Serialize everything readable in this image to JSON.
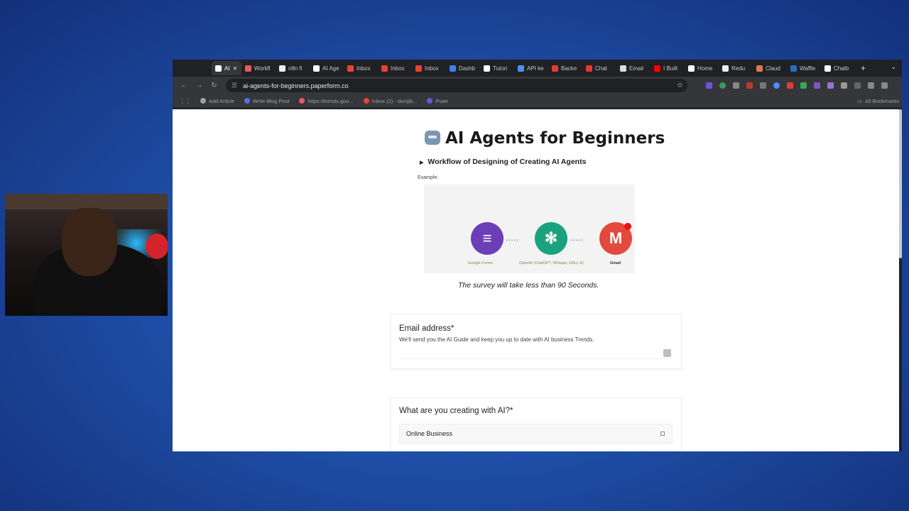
{
  "browser": {
    "tabs": [
      {
        "label": "AI",
        "color": "#ffffff",
        "active": true
      },
      {
        "label": "Workfl",
        "color": "#e65b5b"
      },
      {
        "label": "n8n fi",
        "color": "#eeeeee"
      },
      {
        "label": "AI Age",
        "color": "#ffffff"
      },
      {
        "label": "Inbox",
        "color": "#e94235"
      },
      {
        "label": "Inbox",
        "color": "#e94235"
      },
      {
        "label": "Inbox",
        "color": "#e94235"
      },
      {
        "label": "Dashb",
        "color": "#3d7ff5"
      },
      {
        "label": "Tutori",
        "color": "#ffffff"
      },
      {
        "label": "API ke",
        "color": "#4f8ef7"
      },
      {
        "label": "Backe",
        "color": "#e53935"
      },
      {
        "label": "Chat",
        "color": "#e53935"
      },
      {
        "label": "Email",
        "color": "#dddddd"
      },
      {
        "label": "I Built",
        "color": "#ff0000"
      },
      {
        "label": "Home",
        "color": "#ffffff"
      },
      {
        "label": "Redu",
        "color": "#eeeeee"
      },
      {
        "label": "Claud",
        "color": "#d97757"
      },
      {
        "label": "Waffle",
        "color": "#2a6ebb"
      },
      {
        "label": "Chatb",
        "color": "#ffffff"
      }
    ],
    "url": "ai-agents-for-beginners.paperform.co",
    "bookmarks": [
      {
        "label": "Add Article",
        "color": "#9aa0a6"
      },
      {
        "label": "Write Blog Post",
        "color": "#5b6ee1"
      },
      {
        "label": "https://trends.goo...",
        "color": "#e65b5b"
      },
      {
        "label": "Inbox (2) - docijib...",
        "color": "#e94235"
      },
      {
        "label": "Puter",
        "color": "#6b55d6"
      }
    ],
    "all_bookmarks": "All Bookmarks"
  },
  "page": {
    "title": "AI Agents for Beginners",
    "workflow_toggle": "Workflow of Designing of Creating AI Agents",
    "example_label": "Example:",
    "diagram": {
      "nodes": [
        {
          "name": "Google Forms",
          "glyph": "≡"
        },
        {
          "name": "OpenAI (ChatGPT, Whisper, DALL-E)",
          "glyph": "✻"
        },
        {
          "name": "Gmail",
          "glyph": "M"
        }
      ],
      "badge": "1"
    },
    "survey_note": "The survey will take less than 90 Seconds.",
    "questions": {
      "email": {
        "label": "Email address*",
        "description": "We'll send you the AI Guide and keep you up to date with AI business Trends."
      },
      "creating": {
        "label": "What are you creating with AI?*",
        "option": "Online Business"
      }
    }
  }
}
